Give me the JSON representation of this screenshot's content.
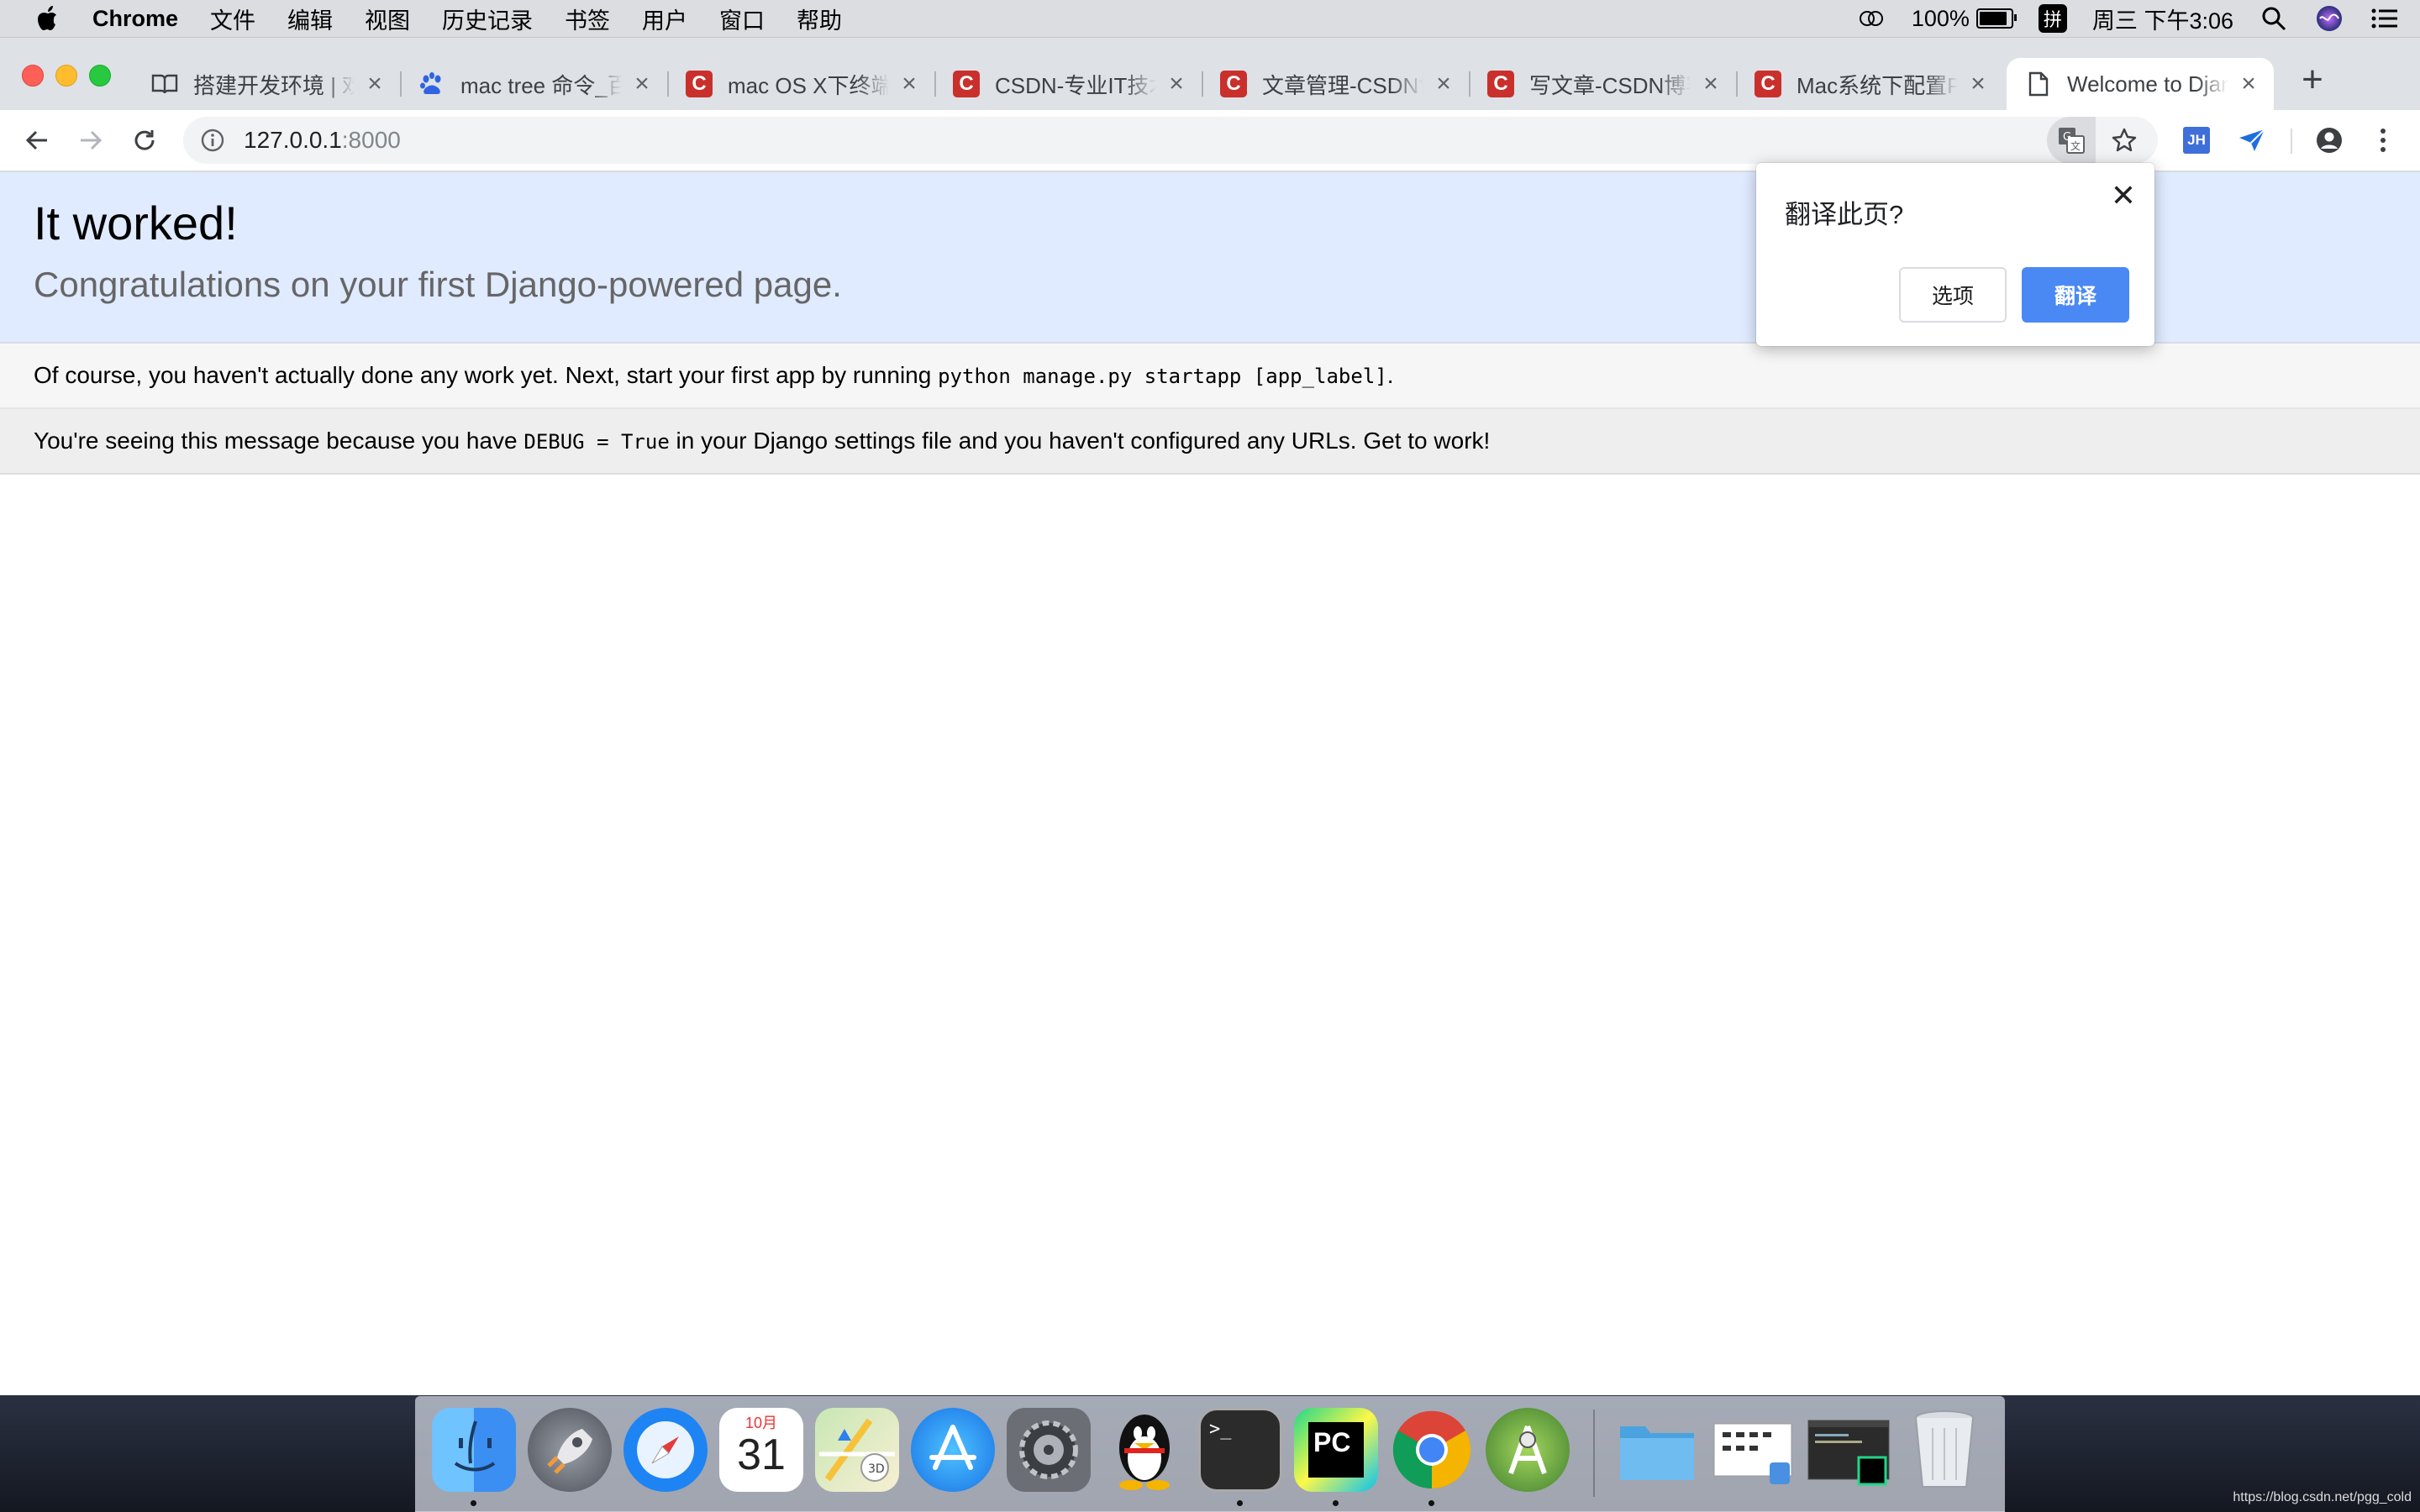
{
  "menubar": {
    "app_name": "Chrome",
    "items": [
      "文件",
      "编辑",
      "视图",
      "历史记录",
      "书签",
      "用户",
      "窗口",
      "帮助"
    ],
    "battery_percent": "100%",
    "battery_level": 1.0,
    "input_method": "拼",
    "clock": "周三 下午3:06"
  },
  "tabs": [
    {
      "title": "搭建开发环境 | 欢",
      "icon": "book-icon"
    },
    {
      "title": "mac tree 命令_百",
      "icon": "baidu-paw-icon"
    },
    {
      "title": "mac OS X下终端",
      "icon": "csdn-icon"
    },
    {
      "title": "CSDN-专业IT技术",
      "icon": "csdn-icon"
    },
    {
      "title": "文章管理-CSDN博",
      "icon": "csdn-icon"
    },
    {
      "title": "写文章-CSDN博客",
      "icon": "csdn-icon"
    },
    {
      "title": "Mac系统下配置P",
      "icon": "csdn-icon"
    },
    {
      "title": "Welcome to Django",
      "icon": "page-icon"
    }
  ],
  "toolbar": {
    "url_host": "127.0.0.1",
    "url_port": ":8000"
  },
  "page": {
    "heading": "It worked!",
    "subheading": "Congratulations on your first Django-powered page.",
    "instructions_pre": "Of course, you haven't actually done any work yet. Next, start your first app by running ",
    "instructions_code": "python manage.py startapp [app_label]",
    "instructions_post": ".",
    "explanation_pre": "You're seeing this message because you have ",
    "explanation_code": "DEBUG = True",
    "explanation_post": " in your Django settings file and you haven't configured any URLs. Get to work!"
  },
  "translate_popup": {
    "question": "翻译此页?",
    "options_label": "选项",
    "translate_label": "翻译"
  },
  "dock": {
    "calendar_month": "10月",
    "calendar_day": "31",
    "terminal_prompt": ">_",
    "pycharm_label": "PC"
  },
  "watermark": "https://blog.csdn.net/pgg_cold",
  "colors": {
    "summary_bg": "#e0ebff",
    "translate_button": "#4a89f3",
    "csdn_red": "#c9302c"
  }
}
